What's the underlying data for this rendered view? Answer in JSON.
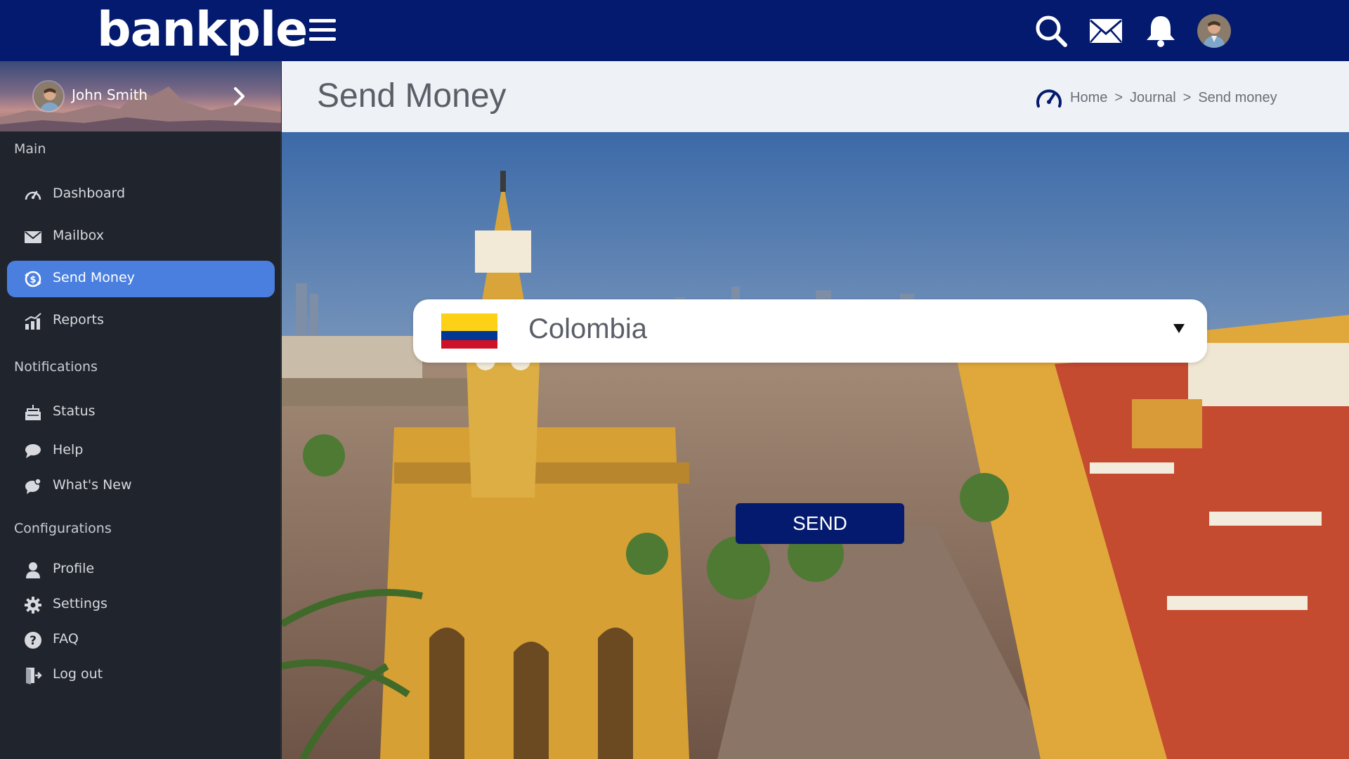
{
  "app": {
    "logo_text": "bankple"
  },
  "topbar": {
    "icons": [
      "menu-icon",
      "search-icon",
      "mail-icon",
      "bell-icon",
      "avatar"
    ]
  },
  "user": {
    "name": "John Smith"
  },
  "sidebar": {
    "sections": [
      {
        "label": "Main",
        "items": [
          {
            "label": "Dashboard",
            "icon": "dashboard-icon"
          },
          {
            "label": "Mailbox",
            "icon": "mail-icon"
          },
          {
            "label": "Send Money",
            "icon": "send-money-icon",
            "active": true
          },
          {
            "label": "Reports",
            "icon": "reports-icon"
          }
        ]
      },
      {
        "label": "Notifications",
        "items": [
          {
            "label": "Status",
            "icon": "status-icon"
          },
          {
            "label": "Help",
            "icon": "help-chat-icon"
          },
          {
            "label": "What's New",
            "icon": "whats-new-icon"
          }
        ]
      },
      {
        "label": "Configurations",
        "items": [
          {
            "label": "Profile",
            "icon": "profile-icon"
          },
          {
            "label": "Settings",
            "icon": "gear-icon"
          },
          {
            "label": "FAQ",
            "icon": "question-icon"
          },
          {
            "label": "Log out",
            "icon": "logout-icon"
          }
        ]
      }
    ]
  },
  "header": {
    "title": "Send Money",
    "breadcrumb": [
      "Home",
      "Journal",
      "Send money"
    ],
    "breadcrumb_sep": ">"
  },
  "form": {
    "country": "Colombia",
    "send_label": "SEND"
  },
  "colors": {
    "primary": "#041a6e",
    "active_nav": "#4a7fe0",
    "sidebar_bg": "#20252d"
  }
}
